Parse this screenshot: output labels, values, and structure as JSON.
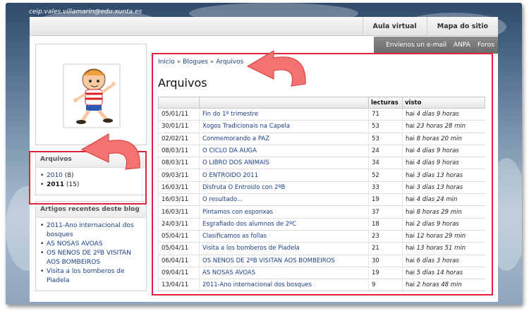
{
  "header": {
    "email": "ceip.vales.villamarin@edu.xunta.es",
    "nav": [
      "Aula virtual",
      "Mapa do sitio"
    ],
    "subnav": [
      "Envíenos un e-mail",
      "ANPA",
      "Foros"
    ]
  },
  "breadcrumb": [
    "Inicio",
    "Blogues",
    "Arquivos"
  ],
  "page_title": "Arquivos",
  "table": {
    "columns": [
      "",
      "",
      "lecturas",
      "visto"
    ],
    "rows": [
      {
        "date": "05/01/11",
        "title": "Fin do 1º trimestre",
        "reads": "71",
        "ago": "hai ",
        "ago_em": "4 días 9 horas"
      },
      {
        "date": "30/01/11",
        "title": "Xogos Tradicionais na Capela",
        "reads": "53",
        "ago": "hai ",
        "ago_em": "23 horas 28 min"
      },
      {
        "date": "02/02/11",
        "title": "Conmemorando a PAZ",
        "reads": "53",
        "ago": "hai ",
        "ago_em": "8 horas 20 min"
      },
      {
        "date": "08/03/11",
        "title": "O CICLO DA AUGA",
        "reads": "24",
        "ago": "hai ",
        "ago_em": "4 días 9 horas"
      },
      {
        "date": "08/03/11",
        "title": "O LIBRO DOS ANIMAIS",
        "reads": "34",
        "ago": "hai ",
        "ago_em": "4 días 9 horas"
      },
      {
        "date": "09/03/11",
        "title": "O ENTROIDO 2011",
        "reads": "52",
        "ago": "hai ",
        "ago_em": "3 días 13 horas"
      },
      {
        "date": "16/03/11",
        "title": "Disfruta O Entroido con 2ºB",
        "reads": "33",
        "ago": "hai ",
        "ago_em": "3 días 13 horas"
      },
      {
        "date": "16/03/11",
        "title": "O resultado...",
        "reads": "19",
        "ago": "hai ",
        "ago_em": "4 días 24 min"
      },
      {
        "date": "16/03/11",
        "title": "Pintamos con esponxas",
        "reads": "37",
        "ago": "hai ",
        "ago_em": "8 horas 29 min"
      },
      {
        "date": "24/03/11",
        "title": "Esgrafiado dos alumnos de 2ºC",
        "reads": "18",
        "ago": "hai ",
        "ago_em": "2 días 9 horas"
      },
      {
        "date": "05/04/11",
        "title": "Clasificamos as follas",
        "reads": "23",
        "ago": "hai ",
        "ago_em": "12 horas 29 min"
      },
      {
        "date": "05/04/11",
        "title": "Visita a los bomberos de Piadela",
        "reads": "21",
        "ago": "hai ",
        "ago_em": "13 horas 51 min"
      },
      {
        "date": "06/04/11",
        "title": "OS NENOS DE 2ºB VISITAN AOS BOMBEIROS",
        "reads": "30",
        "ago": "hai ",
        "ago_em": "6 días 3 horas"
      },
      {
        "date": "09/04/11",
        "title": "AS NOSAS AVOAS",
        "reads": "19",
        "ago": "hai ",
        "ago_em": "5 días 14 horas"
      },
      {
        "date": "13/04/11",
        "title": "2011-Ano internacional dos bosques",
        "reads": "9",
        "ago": "hai ",
        "ago_em": "2 horas 48 min"
      }
    ]
  },
  "sidebar": {
    "archive_title": "Arquivos",
    "years": [
      {
        "year": "2010",
        "count": " (8)"
      },
      {
        "year": "2011",
        "count": " (15)"
      }
    ],
    "recent_title": "Artigos recentes deste blog",
    "recent": [
      "2011-Ano internacional dos bosques",
      "AS NOSAS AVOAS",
      "OS NENOS DE 2ºB VISITAN AOS BOMBEIROS",
      "Visita a los bomberos de Piadela"
    ]
  },
  "colors": {
    "highlight": "#e0223a",
    "link": "#1a3f86",
    "arrow": "#f2736f"
  },
  "icons": [
    "boy-running-logo",
    "curved-arrow-icon"
  ]
}
